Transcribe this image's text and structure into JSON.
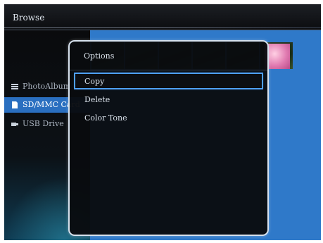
{
  "header": {
    "title": "Browse"
  },
  "sidebar": {
    "items": [
      {
        "label": "PhotoAlbum",
        "icon": "list-icon",
        "selected": false
      },
      {
        "label": "SD/MMC Card",
        "icon": "card-icon",
        "selected": true
      },
      {
        "label": "USB Drive",
        "icon": "usb-icon",
        "selected": false
      }
    ]
  },
  "dialog": {
    "title": "Options",
    "options": [
      {
        "label": "Copy",
        "selected": true
      },
      {
        "label": "Delete",
        "selected": false
      },
      {
        "label": "Color Tone",
        "selected": false
      }
    ]
  },
  "colors": {
    "accent": "#2a6fc0",
    "selection_outline": "#4ea0ff",
    "background_blue": "#2f79c9"
  }
}
